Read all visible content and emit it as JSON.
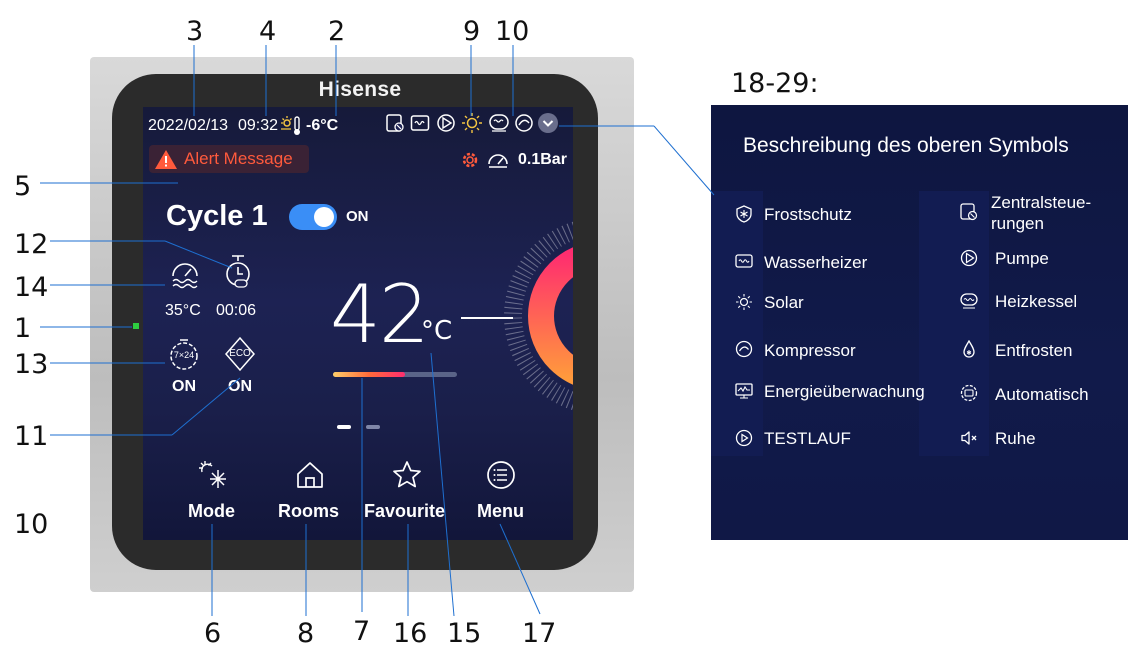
{
  "callouts": {
    "c3": "3",
    "c4": "4",
    "c2": "2",
    "c9": "9",
    "c10_top": "10",
    "c5": "5",
    "c12": "12",
    "c14": "14",
    "c1": "1",
    "c13": "13",
    "c11": "11",
    "c10_left": "10",
    "c6": "6",
    "c8": "8",
    "c7": "7",
    "c16": "16",
    "c15": "15",
    "c17": "17",
    "range_label": "18-29:"
  },
  "device": {
    "brand": "Hisense",
    "status_bar": {
      "date": "2022/02/13",
      "time": "09:32",
      "outdoor_temp": "-6°C",
      "pressure": "0.1Bar"
    },
    "alert": "Alert Message",
    "cycle": {
      "label": "Cycle 1",
      "toggle_state": "ON"
    },
    "widgets": {
      "water_temp": "35°C",
      "timer": "00:06",
      "schedule_icon_text": "7×24",
      "schedule_state": "ON",
      "eco_icon_text": "ECO",
      "eco_state": "ON"
    },
    "temperature": {
      "value": "42",
      "unit": "°C"
    },
    "nav": [
      {
        "label": "Mode",
        "icon": "snowflake-sun-icon"
      },
      {
        "label": "Rooms",
        "icon": "home-icon"
      },
      {
        "label": "Favourite",
        "icon": "star-icon"
      },
      {
        "label": "Menu",
        "icon": "menu-list-icon"
      }
    ],
    "colors": {
      "screen_bg": "#1d2253",
      "ring_start": "#ff2d6f",
      "ring_end": "#ff9a3c",
      "alert": "#ff5a3c",
      "toggle": "#3a8ef6"
    }
  },
  "panel": {
    "title": "Beschreibung des oberen Symbols",
    "left_items": [
      {
        "label": "Frostschutz",
        "icon": "frost-protection-icon"
      },
      {
        "label": "Wasserheizer",
        "icon": "water-heater-icon"
      },
      {
        "label": "Solar",
        "icon": "solar-icon"
      },
      {
        "label": "Kompressor",
        "icon": "compressor-icon"
      },
      {
        "label": "Energieüberwachung",
        "icon": "energy-monitor-icon"
      },
      {
        "label": "TESTLAUF",
        "icon": "test-run-icon"
      }
    ],
    "right_items": [
      {
        "label_line1": "Zentralsteue-",
        "label_line2": "rungen",
        "icon": "central-control-icon"
      },
      {
        "label": "Pumpe",
        "icon": "pump-icon"
      },
      {
        "label": "Heizkessel",
        "icon": "boiler-icon"
      },
      {
        "label": "Entfrosten",
        "icon": "defrost-icon"
      },
      {
        "label": "Automatisch",
        "icon": "auto-icon"
      },
      {
        "label": "Ruhe",
        "icon": "mute-icon"
      }
    ]
  }
}
